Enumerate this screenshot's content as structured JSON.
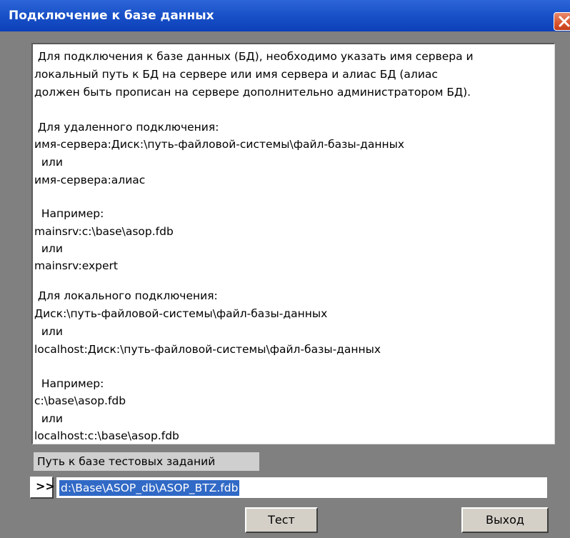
{
  "window": {
    "title": "Подключение к базе данных"
  },
  "help": {
    "lines": [
      " Для подключения к базе данных (БД), необходимо указать имя сервера и",
      "локальный путь к БД на сервере или имя сервера и алиас БД (алиас",
      "должен быть прописан на сервере дополнительно администратором БД).",
      "",
      " Для удаленного подключения:",
      "имя-сервера:Диск:\\путь-файловой-системы\\файл-базы-данных",
      "  или",
      "имя-сервера:алиас",
      "",
      "  Например:",
      "mainsrv:c:\\base\\asop.fdb",
      "  или",
      "mainsrv:expert",
      "",
      " Для локального подключения:",
      "Диск:\\путь-файловой-системы\\файл-базы-данных",
      "  или",
      "localhost:Диск:\\путь-файловой-системы\\файл-базы-данных",
      "",
      "  Например:",
      "c:\\base\\asop.fdb",
      "  или",
      "localhost:c:\\base\\asop.fdb"
    ]
  },
  "path": {
    "label": "Путь к базе тестовых заданий",
    "browse_label": ">>",
    "value": "d:\\Base\\ASOP_db\\ASOP_BTZ.fdb"
  },
  "buttons": {
    "test": "Тест",
    "exit": "Выход"
  },
  "colors": {
    "titlebar": "#1a52c9",
    "close": "#d9552e",
    "selection": "#3169c6",
    "background": "#808080"
  }
}
